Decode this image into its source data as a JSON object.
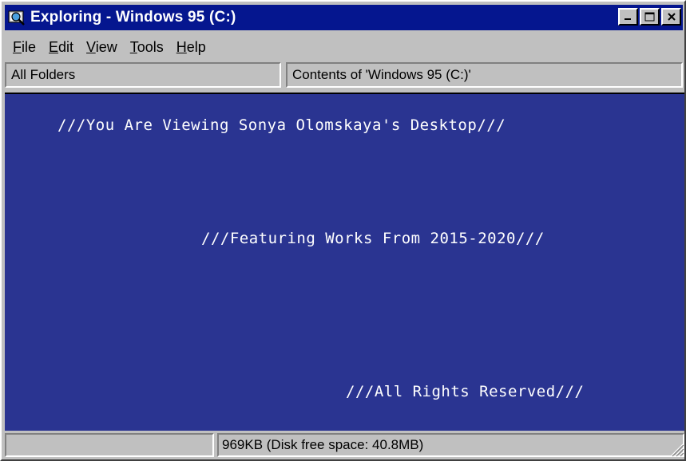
{
  "window": {
    "title": "Exploring - Windows 95 (C:)",
    "icon": "explorer-icon",
    "controls": [
      "minimize",
      "maximize",
      "close"
    ]
  },
  "menu": [
    {
      "label": "File",
      "accel": "F",
      "rest": "ile"
    },
    {
      "label": "Edit",
      "accel": "E",
      "rest": "dit"
    },
    {
      "label": "View",
      "accel": "V",
      "rest": "iew"
    },
    {
      "label": "Tools",
      "accel": "T",
      "rest": "ools"
    },
    {
      "label": "Help",
      "accel": "H",
      "rest": "elp"
    }
  ],
  "panes": {
    "left_header": "All Folders",
    "right_header": "Contents of 'Windows 95 (C:)'"
  },
  "content": {
    "line1": "///You Are Viewing Sonya Olomskaya's Desktop///",
    "line2": "///Featuring Works From 2015-2020///",
    "line3": "///All Rights Reserved///",
    "background": "#2a3491"
  },
  "status": {
    "left": "",
    "right": "969KB (Disk free space: 40.8MB)"
  },
  "colors": {
    "titlebar": "#05168f",
    "chrome": "#c0c0c0"
  }
}
